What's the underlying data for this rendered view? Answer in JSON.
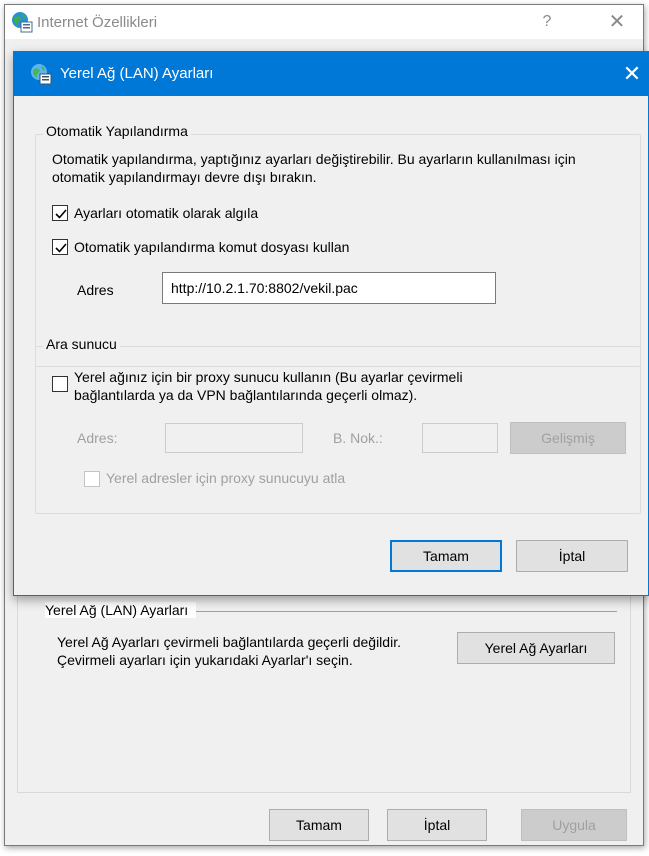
{
  "outer_window": {
    "title": "Internet Özellikleri",
    "help_glyph": "?",
    "close_glyph": "✕",
    "lan_section": {
      "title": "Yerel Ağ (LAN) Ayarları",
      "description": "Yerel Ağ Ayarları çevirmeli bağlantılarda geçerli değildir. Çevirmeli ayarları için yukarıdaki Ayarlar'ı seçin.",
      "lan_settings_button": "Yerel Ağ Ayarları"
    },
    "buttons": {
      "ok": "Tamam",
      "cancel": "İptal",
      "apply": "Uygula"
    }
  },
  "dialog": {
    "title": "Yerel Ağ (LAN) Ayarları",
    "close_glyph": "✕",
    "auto_config": {
      "group_title": "Otomatik Yapılandırma",
      "description": "Otomatik yapılandırma, yaptığınız ayarları değiştirebilir. Bu ayarların kullanılması için otomatik yapılandırmayı devre dışı bırakın.",
      "auto_detect": {
        "label": "Ayarları otomatik olarak algıla",
        "checked": true
      },
      "use_script": {
        "label": "Otomatik yapılandırma komut dosyası kullan",
        "checked": true
      },
      "address_label": "Adres",
      "address_value": "http://10.2.1.70:8802/vekil.pac"
    },
    "proxy": {
      "group_title": "Ara sunucu",
      "use_proxy": {
        "label_line1": "Yerel ağınız için bir proxy sunucu kullanın (Bu ayarlar çevirmeli",
        "label_line2": "bağlantılarda ya da VPN bağlantılarında geçerli olmaz).",
        "checked": false
      },
      "address_label": "Adres:",
      "address_value": "",
      "port_label": "B. Nok.:",
      "port_value": "",
      "advanced_button": "Gelişmiş",
      "bypass_local": {
        "label": "Yerel adresler için proxy sunucuyu atla",
        "checked": false
      }
    },
    "buttons": {
      "ok": "Tamam",
      "cancel": "İptal"
    }
  },
  "colors": {
    "accent": "#0078d7",
    "disabled_text": "#a0a0a0",
    "window_bg": "#f0f0f0"
  },
  "icons": {
    "app": "internet-options-icon",
    "check": "check-icon",
    "close": "close-icon",
    "help": "help-icon"
  }
}
